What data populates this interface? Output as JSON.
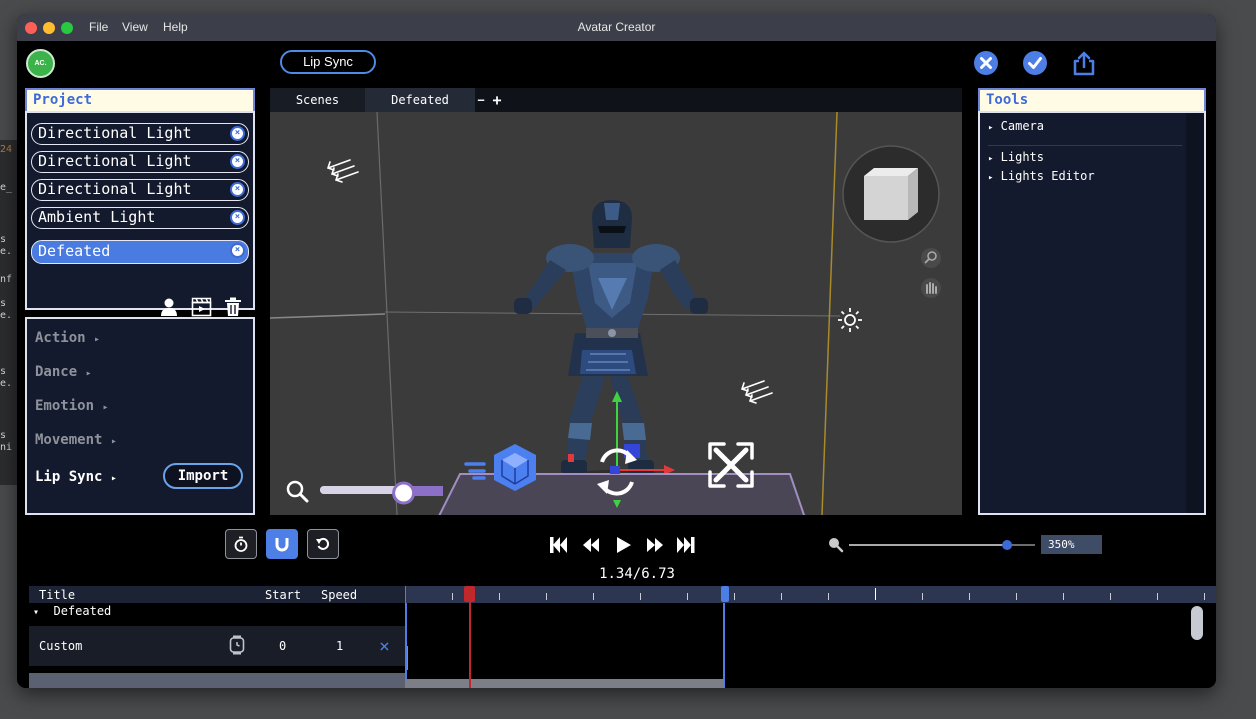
{
  "background_code": [
    "24",
    "e_",
    "s",
    "e.",
    "nf",
    "s",
    "e.",
    "s",
    "e.",
    "s",
    "ni"
  ],
  "window": {
    "menu": [
      "File",
      "View",
      "Help"
    ],
    "title": "Avatar Creator",
    "traffic_colors": [
      "#fe5f57",
      "#febc2e",
      "#28c840"
    ]
  },
  "toolbar": {
    "avatar_initials": "AC.",
    "mode_pill": "Lip Sync",
    "icons": [
      "close-icon",
      "confirm-check-icon",
      "share-icon"
    ]
  },
  "project": {
    "title": "Project",
    "items": [
      {
        "label": "Directional Light",
        "selected": false
      },
      {
        "label": "Directional Light",
        "selected": false
      },
      {
        "label": "Directional Light",
        "selected": false
      },
      {
        "label": "Ambient Light",
        "selected": false
      },
      {
        "label": "Defeated",
        "selected": true
      }
    ],
    "remove_glyph": "×",
    "tool_icons": [
      "person-icon",
      "clapperboard-icon",
      "trash-icon"
    ]
  },
  "categories": {
    "items": [
      "Action",
      "Dance",
      "Emotion",
      "Movement",
      "Lip Sync"
    ],
    "arrow": "▸",
    "active": "Lip Sync",
    "import_label": "Import"
  },
  "viewport": {
    "tabs": [
      "Scenes",
      "Defeated"
    ],
    "tab_minus": "−",
    "tab_plus": "+",
    "zoom_slider_value": 0.68
  },
  "tools": {
    "title": "Tools",
    "items": [
      "Camera",
      "Lights",
      "Lights Editor"
    ],
    "arrow": "▸"
  },
  "playback": {
    "timecode": "1.34/6.73",
    "zoom_value": "350%",
    "zoom_slider_value": 0.85,
    "ctrl_icons": [
      "stopwatch-icon",
      "magnet-icon",
      "reset-icon"
    ],
    "transport_icons": [
      "skip-start-icon",
      "rewind-icon",
      "play-icon",
      "fast-forward-icon",
      "skip-end-icon"
    ]
  },
  "timeline": {
    "columns": {
      "title": "Title",
      "start": "Start",
      "speed": "Speed"
    },
    "group": "Defeated",
    "group_arrow": "▾",
    "row": {
      "title": "Custom",
      "start": "0",
      "speed": "1",
      "remove": "×"
    },
    "playhead_red_position": 0.08,
    "playhead_blue_position": 0.395
  },
  "colors": {
    "accent": "#4d7ee5",
    "panel_bg": "#141a2d",
    "header_bg": "#fffbe4",
    "playhead_red": "#c0282b"
  }
}
